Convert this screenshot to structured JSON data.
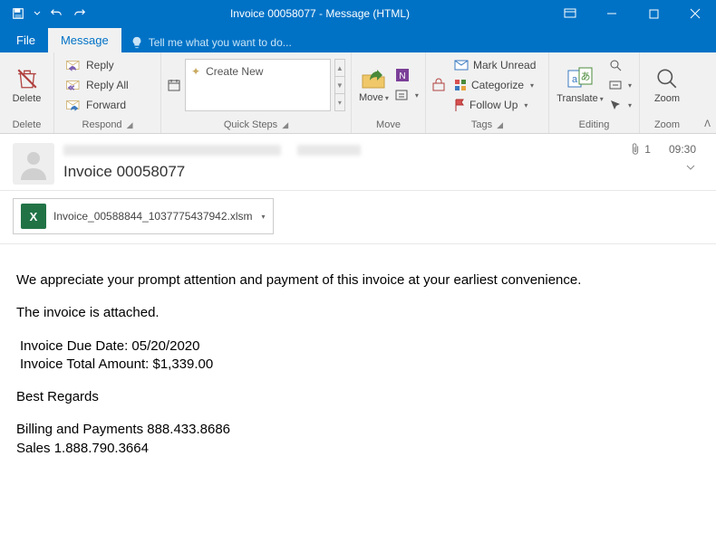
{
  "window": {
    "title": "Invoice 00058077 - Message (HTML)"
  },
  "tabs": {
    "file": "File",
    "message": "Message",
    "tellme": "Tell me what you want to do..."
  },
  "ribbon": {
    "delete": {
      "btn": "Delete",
      "group": "Delete"
    },
    "respond": {
      "reply": "Reply",
      "replyAll": "Reply All",
      "forward": "Forward",
      "group": "Respond"
    },
    "quicksteps": {
      "createNew": "Create New",
      "group": "Quick Steps"
    },
    "move": {
      "btn": "Move",
      "group": "Move"
    },
    "tags": {
      "markUnread": "Mark Unread",
      "categorize": "Categorize",
      "followUp": "Follow Up",
      "group": "Tags"
    },
    "editing": {
      "translate": "Translate",
      "group": "Editing"
    },
    "zoom": {
      "btn": "Zoom",
      "group": "Zoom"
    }
  },
  "header": {
    "subject": "Invoice 00058077",
    "attachCount": "1",
    "time": "09:30"
  },
  "attachment": {
    "name": "Invoice_00588844_1037775437942.xlsm"
  },
  "body": {
    "l1": "We appreciate your prompt attention and payment of this invoice at your earliest convenience.",
    "l2": "The invoice is attached.",
    "l3": "Invoice Due Date: 05/20/2020",
    "l4": "Invoice Total Amount: $1,339.00",
    "l5": "Best Regards",
    "l6": "Billing and Payments 888.433.8686",
    "l7": "Sales 1.888.790.3664"
  }
}
